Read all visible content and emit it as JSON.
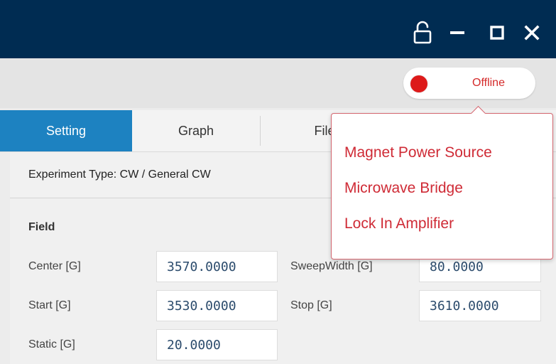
{
  "titlebar": {
    "icons": [
      "lock-open-icon",
      "minimize-icon",
      "maximize-icon",
      "close-icon"
    ],
    "color": "#002c52"
  },
  "status": {
    "text": "Offline",
    "dot_color": "#dd1a1a",
    "text_color": "#d42a2a"
  },
  "tabs": [
    {
      "label": "Setting",
      "active": true
    },
    {
      "label": "Graph",
      "active": false
    },
    {
      "label": "File",
      "active": false
    }
  ],
  "accent_color": "#1d82c1",
  "experiment": {
    "label": "Experiment Type: CW / General CW"
  },
  "field": {
    "title": "Field",
    "center": {
      "label": "Center [G]",
      "value": "3570.0000"
    },
    "sweep_width": {
      "label": "SweepWidth [G]",
      "value": "80.0000"
    },
    "start": {
      "label": "Start [G]",
      "value": "3530.0000"
    },
    "stop": {
      "label": "Stop [G]",
      "value": "3610.0000"
    },
    "static": {
      "label": "Static [G]",
      "value": "20.0000"
    }
  },
  "popover": {
    "items": [
      "Magnet Power Source",
      "Microwave Bridge",
      "Lock In Amplifier"
    ],
    "color": "#cf2b36"
  }
}
